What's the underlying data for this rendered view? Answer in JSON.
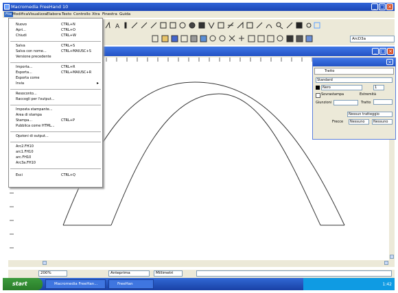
{
  "window": {
    "title": "Macromedia FreeHand 10"
  },
  "menubar": [
    "File",
    "Modifica",
    "Visualizza",
    "Elabora",
    "Testo",
    "Controllo",
    "Xtra",
    "Finestra",
    "Guida"
  ],
  "file_menu": {
    "items": [
      {
        "label": "Nuovo",
        "shortcut": "CTRL+N"
      },
      {
        "label": "Apri...",
        "shortcut": "CTRL+O"
      },
      {
        "label": "Chiudi",
        "shortcut": "CTRL+W"
      },
      {
        "label": "Salva",
        "shortcut": "CTRL+S"
      },
      {
        "label": "Salva con nome...",
        "shortcut": "CTRL+MAIUSC+S"
      },
      {
        "label": "Versione precedente",
        "shortcut": ""
      },
      {
        "label": "Importa...",
        "shortcut": "CTRL+R"
      },
      {
        "label": "Esporta...",
        "shortcut": "CTRL+MAIUSC+R"
      },
      {
        "label": "Esporta come",
        "shortcut": ""
      },
      {
        "label": "Invia",
        "shortcut": ""
      },
      {
        "label": "Resoconto...",
        "shortcut": ""
      },
      {
        "label": "Raccogli per l'output...",
        "shortcut": ""
      },
      {
        "label": "Imposta stampante...",
        "shortcut": ""
      },
      {
        "label": "Area di stampa",
        "shortcut": ""
      },
      {
        "label": "Stampa...",
        "shortcut": "CTRL+P"
      },
      {
        "label": "Pubblica come HTML...",
        "shortcut": ""
      },
      {
        "label": "Opzioni di output...",
        "shortcut": ""
      },
      {
        "label": "Arc2.FH10",
        "shortcut": ""
      },
      {
        "label": "arc1.FH10",
        "shortcut": ""
      },
      {
        "label": "arc.FH10",
        "shortcut": ""
      },
      {
        "label": "Arc3a.FH10",
        "shortcut": ""
      },
      {
        "label": "Esci",
        "shortcut": "CTRL+Q"
      }
    ]
  },
  "toolbar": {
    "zoom_field": "ArcD3a"
  },
  "statusbar": {
    "zoom": "200%",
    "mode": "Anteprima",
    "units": "Millimetri"
  },
  "panel": {
    "tab": "Tratto",
    "stroke_type": "Standard",
    "color": "Nero",
    "width": "1",
    "overprint_label": "Sovrastampa",
    "cap_label": "Estremità",
    "join_label": "Giunzioni",
    "miter_label": "Tratto",
    "style_field": "Nessun tratteggio",
    "arrow_label": "Frecce",
    "arrow_left": "Nessuno",
    "arrow_right": "Nessuno"
  },
  "taskbar": {
    "start": "start",
    "items": [
      "Macromedia FreeHan...",
      "FreeHan"
    ],
    "tray_time": "1:42"
  }
}
